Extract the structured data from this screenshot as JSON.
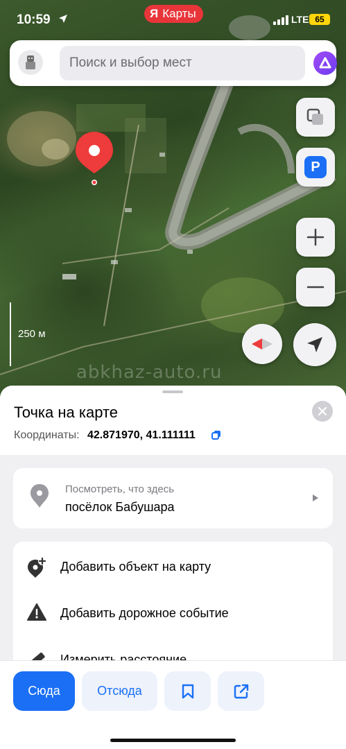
{
  "status_bar": {
    "time": "10:59",
    "app_name": "Карты",
    "app_logo_letter": "Я",
    "network": "LTE",
    "battery": "65"
  },
  "search": {
    "placeholder": "Поиск и выбор мест"
  },
  "map": {
    "scale_label": "250 м",
    "watermark": "abkhaz-auto.ru",
    "icons": [
      "layers-icon",
      "parking-icon",
      "zoom-in-icon",
      "zoom-out-icon",
      "compass-icon",
      "my-location-icon"
    ],
    "parking_label": "P"
  },
  "sheet": {
    "title": "Точка на карте",
    "coords_label": "Координаты:",
    "coords_value": "42.871970, 41.111111",
    "place": {
      "hint": "Посмотреть, что здесь",
      "name": "посёлок Бабушара"
    },
    "actions": [
      {
        "label": "Добавить объект на карту",
        "icon": "add-place-icon"
      },
      {
        "label": "Добавить дорожное событие",
        "icon": "warning-icon"
      },
      {
        "label": "Измерить расстояние",
        "icon": "ruler-icon"
      }
    ]
  },
  "bottom_bar": {
    "to_here": "Сюда",
    "from_here": "Отсюда",
    "bookmark_icon": "bookmark-icon",
    "share_icon": "share-icon"
  },
  "colors": {
    "accent": "#1a6ff5",
    "pin": "#ee3b3b",
    "app_pill": "#e8353a",
    "battery": "#ffd60a"
  }
}
